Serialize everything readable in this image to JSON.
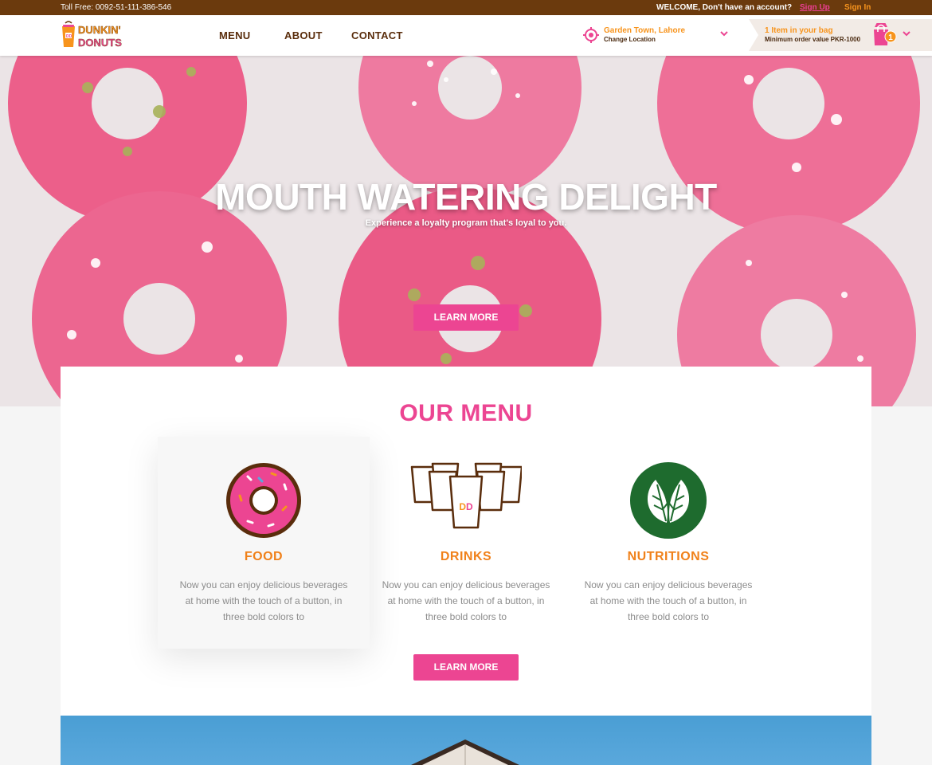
{
  "topbar": {
    "toll_free": "Toll Free: 0092-51-111-386-546",
    "welcome": "WELCOME, Don't have an account?",
    "signup": "Sign Up",
    "signin": "Sign In"
  },
  "header": {
    "logo_text": [
      "DUNKIN'",
      "DONUTS"
    ],
    "nav": [
      "MENU",
      "ABOUT",
      "CONTACT"
    ],
    "location": {
      "name": "Garden Town, Lahore",
      "change": "Change Location"
    },
    "bag": {
      "title": "1 Item in your bag",
      "minimum": "Minimum order value PKR-1000",
      "count": "1"
    }
  },
  "hero": {
    "title": "MOUTH WATERING DELIGHT",
    "subtitle": "Experience a loyalty program that's loyal to you.",
    "button": "LEARN MORE"
  },
  "menu": {
    "title": "OUR MENU",
    "cards": [
      {
        "name": "FOOD",
        "description": "Now you can enjoy delicious beverages at home with the touch of a button, in three bold colors to",
        "icon": "donut-icon"
      },
      {
        "name": "DRINKS",
        "description": "Now you can enjoy delicious beverages at home with the touch of a button, in three bold colors to",
        "icon": "cups-icon"
      },
      {
        "name": "NUTRITIONS",
        "description": "Now you can enjoy delicious beverages at home with the touch of a button, in three bold colors to",
        "icon": "leaf-icon"
      }
    ],
    "button": "LEARN MORE"
  },
  "colors": {
    "brown": "#6b3a0d",
    "pink": "#ec4592",
    "orange": "#f7941d",
    "green": "#1e6b2e"
  }
}
